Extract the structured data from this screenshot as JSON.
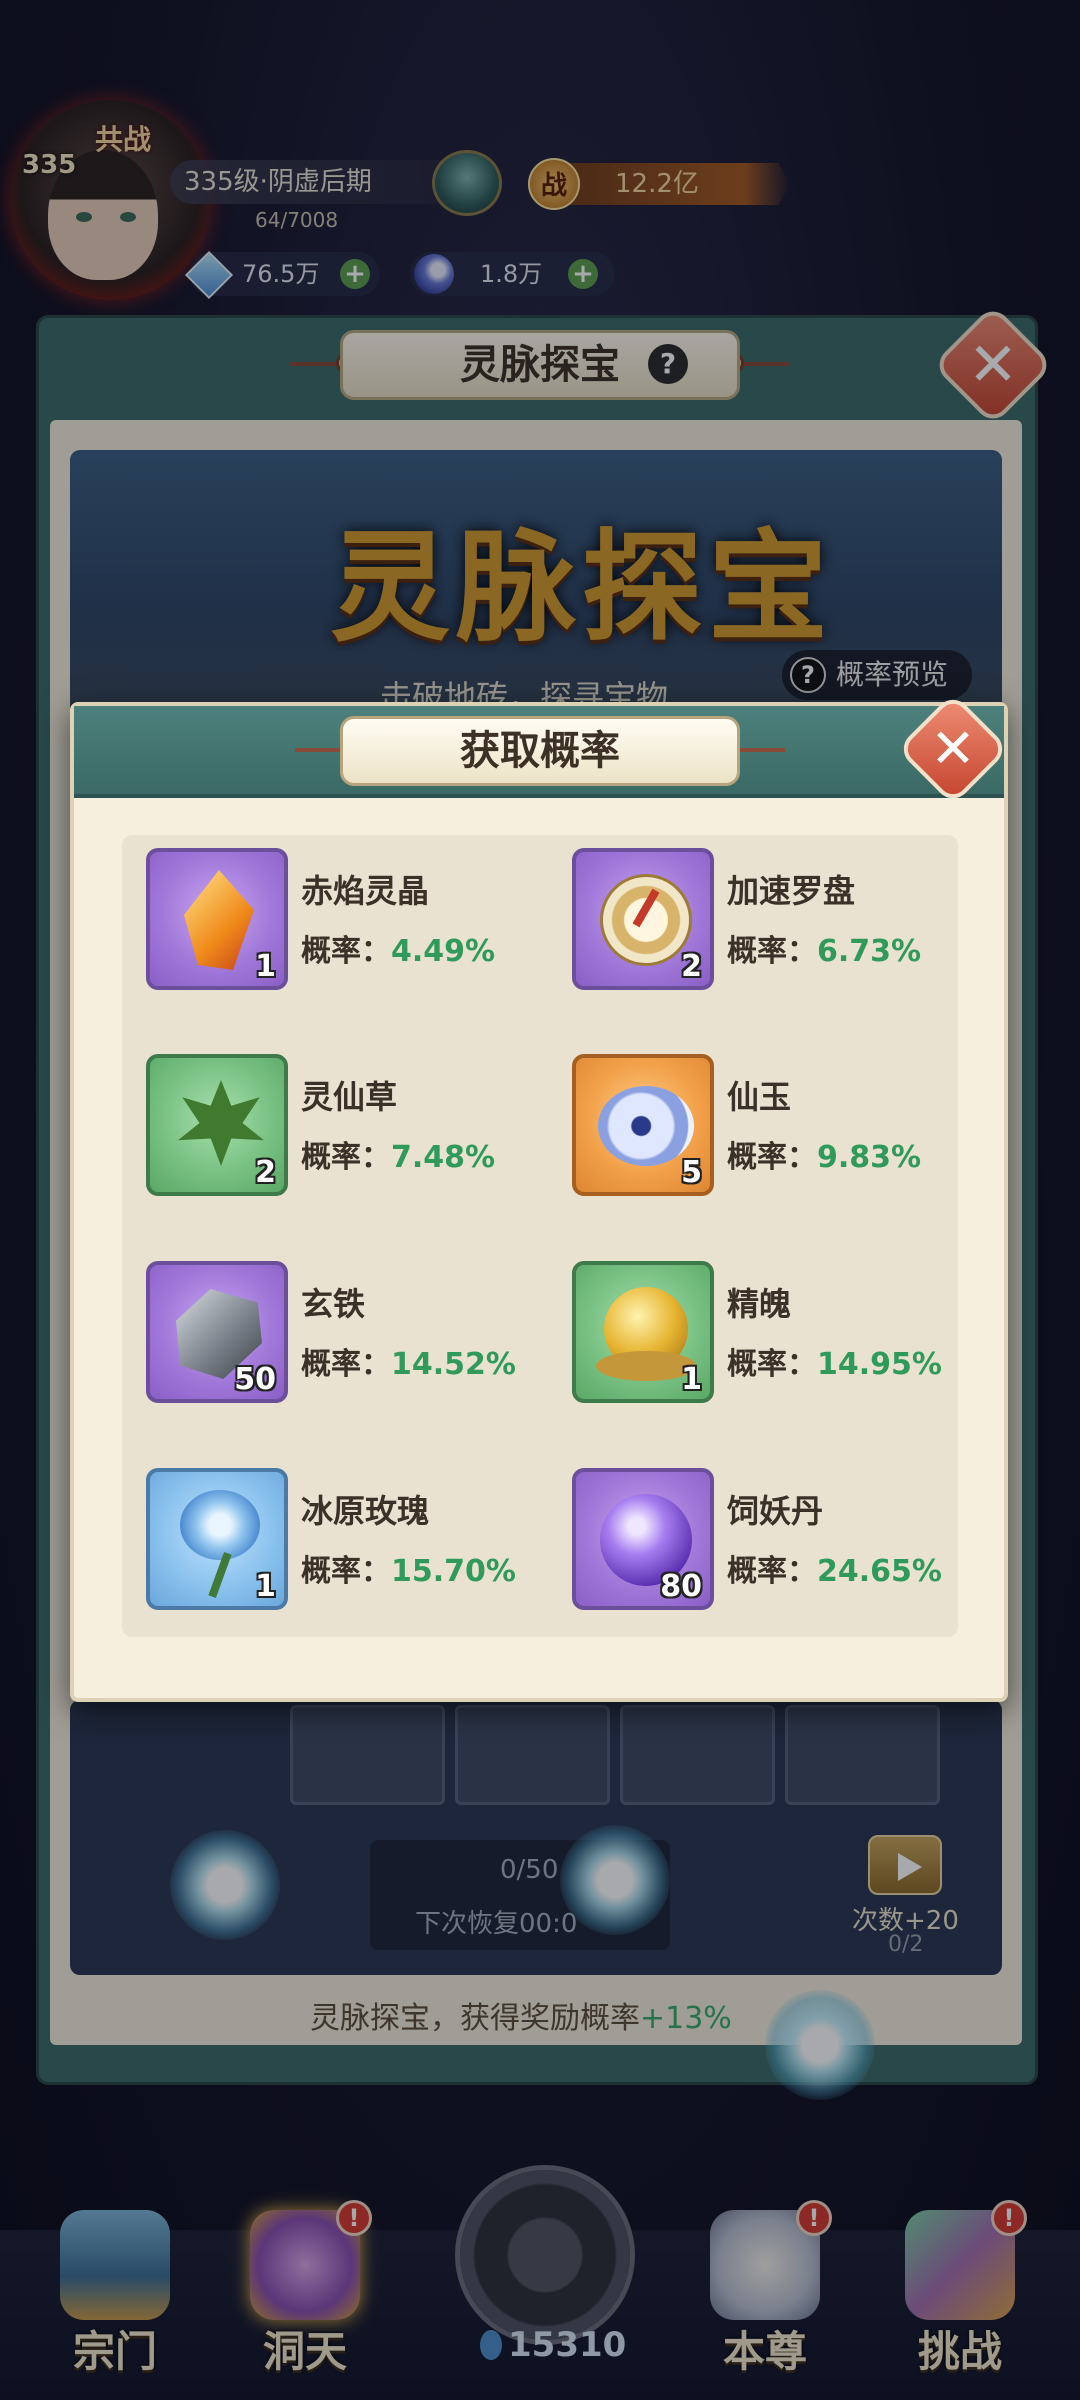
{
  "player": {
    "level_badge": "335",
    "title_text": "共战",
    "rank": "335级·阴虚后期",
    "exp": "64/7008",
    "power": "12.2亿",
    "power_icon": "战",
    "currency_1": "76.5万",
    "currency_2": "1.8万"
  },
  "back_panel": {
    "title": "灵脉探宝",
    "banner_title": "灵脉探宝",
    "banner_subtitle": "击破地砖，探寻宝物",
    "preview_label": "概率预览",
    "count": "0/50",
    "recover": "下次恢复00:0",
    "extra_label": "次数+20",
    "extra_count": "0/2",
    "bonus_prefix": "灵脉探宝，获得奖励概率",
    "bonus_value": "+13%"
  },
  "modal": {
    "title": "获取概率",
    "rate_label": "概率：",
    "items": [
      {
        "name": "赤焰灵晶",
        "rate": "4.49%",
        "qty": "1",
        "icon": "flame-crystal-icon"
      },
      {
        "name": "加速罗盘",
        "rate": "6.73%",
        "qty": "2",
        "icon": "compass-icon"
      },
      {
        "name": "灵仙草",
        "rate": "7.48%",
        "qty": "2",
        "icon": "herb-leaf-icon"
      },
      {
        "name": "仙玉",
        "rate": "9.83%",
        "qty": "5",
        "icon": "jade-swirl-icon"
      },
      {
        "name": "玄铁",
        "rate": "14.52%",
        "qty": "50",
        "icon": "iron-ore-icon"
      },
      {
        "name": "精魄",
        "rate": "14.95%",
        "qty": "1",
        "icon": "spirit-orb-icon"
      },
      {
        "name": "冰原玫瑰",
        "rate": "15.70%",
        "qty": "1",
        "icon": "ice-rose-icon"
      },
      {
        "name": "饲妖丹",
        "rate": "24.65%",
        "qty": "80",
        "icon": "purple-pill-icon"
      }
    ]
  },
  "nav": {
    "sect": "宗门",
    "cave": "洞天",
    "gourd_count": "15310",
    "self": "本尊",
    "challenge": "挑战",
    "badge": "!"
  },
  "colors": {
    "teal_header": "#3b6a66",
    "rate_green": "#2f9a5a",
    "close_red": "#c4432e"
  }
}
